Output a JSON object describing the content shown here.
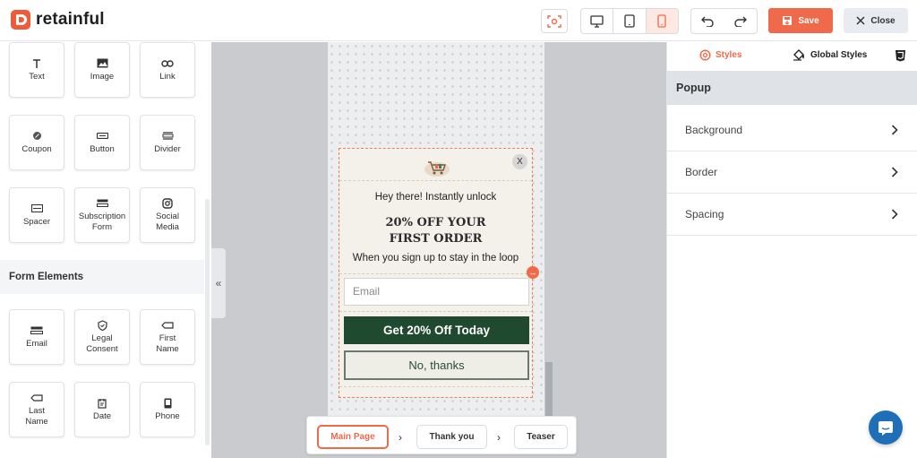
{
  "app": {
    "name": "retainful"
  },
  "toolbar": {
    "save_label": "Save",
    "close_label": "Close",
    "devices": [
      "desktop",
      "tablet",
      "mobile"
    ],
    "active_device": "mobile",
    "accent_color": "#ef6a4a"
  },
  "sidebar": {
    "basic_elements": [
      {
        "label": "Text",
        "icon": "text-icon"
      },
      {
        "label": "Image",
        "icon": "image-icon"
      },
      {
        "label": "Link",
        "icon": "link-icon"
      },
      {
        "label": "Coupon",
        "icon": "coupon-icon"
      },
      {
        "label": "Button",
        "icon": "button-icon"
      },
      {
        "label": "Divider",
        "icon": "divider-icon"
      },
      {
        "label": "Spacer",
        "icon": "spacer-icon"
      },
      {
        "label": "Subscription Form",
        "icon": "form-icon"
      },
      {
        "label": "Social Media",
        "icon": "instagram-icon"
      }
    ],
    "form_section_title": "Form Elements",
    "form_elements": [
      {
        "label": "Email",
        "icon": "email-field-icon"
      },
      {
        "label": "Legal Consent",
        "icon": "shield-icon"
      },
      {
        "label": "First Name",
        "icon": "tag-icon"
      },
      {
        "label": "Last Name",
        "icon": "tag-icon"
      },
      {
        "label": "Date",
        "icon": "calendar-icon"
      },
      {
        "label": "Phone",
        "icon": "phone-icon"
      }
    ]
  },
  "popup": {
    "close_label": "X",
    "heading": "Hey there! Instantly unlock",
    "offer_line1": "20% OFF YOUR",
    "offer_line2": "FIRST ORDER",
    "subtext": "When you sign up to stay in the loop",
    "email_placeholder": "Email",
    "cta_label": "Get 20% Off Today",
    "decline_label": "No, thanks",
    "colors": {
      "background": "#f3f1ea",
      "cta": "#1f4a2f",
      "decline_border": "#6b7a6e"
    }
  },
  "page_tabs": [
    {
      "label": "Main Page",
      "active": true
    },
    {
      "label": "Thank you",
      "active": false
    },
    {
      "label": "Teaser",
      "active": false
    }
  ],
  "right_panel": {
    "tabs": [
      {
        "label": "Styles",
        "active": true
      },
      {
        "label": "Global Styles",
        "active": false
      }
    ],
    "section_title": "Popup",
    "rows": [
      "Background",
      "Border",
      "Spacing"
    ]
  }
}
